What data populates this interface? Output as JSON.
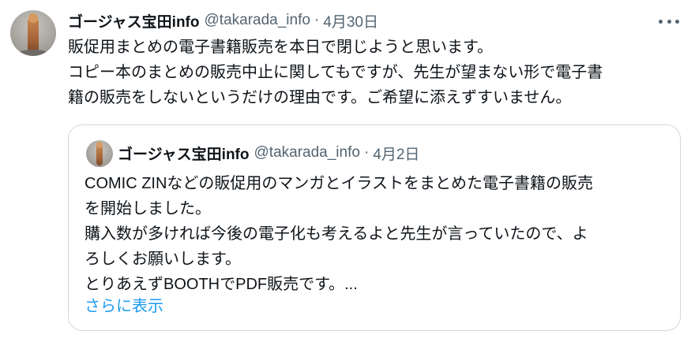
{
  "tweet": {
    "author_name": "ゴージャス宝田info",
    "handle": "@takarada_info",
    "separator": "·",
    "date": "4月30日",
    "lines": [
      "販促用まとめの電子書籍販売を本日で閉じようと思います。",
      "コピー本のまとめの販売中止に関してもですが、先生が望まない形で電子書",
      "籍の販売をしないというだけの理由です。ご希望に添えずすいません。"
    ]
  },
  "quoted_tweet": {
    "author_name": "ゴージャス宝田info",
    "handle": "@takarada_info",
    "separator": "·",
    "date": "4月2日",
    "lines": [
      "COMIC ZINなどの販促用のマンガとイラストをまとめた電子書籍の販売",
      "を開始しました。",
      "購入数が多ければ今後の電子化も考えるよと先生が言っていたので、よ",
      "ろしくお願いします。",
      "とりあえずBOOTHでPDF販売です。..."
    ],
    "show_more": "さらに表示"
  },
  "icons": {
    "more": "more-horizontal-icon"
  }
}
